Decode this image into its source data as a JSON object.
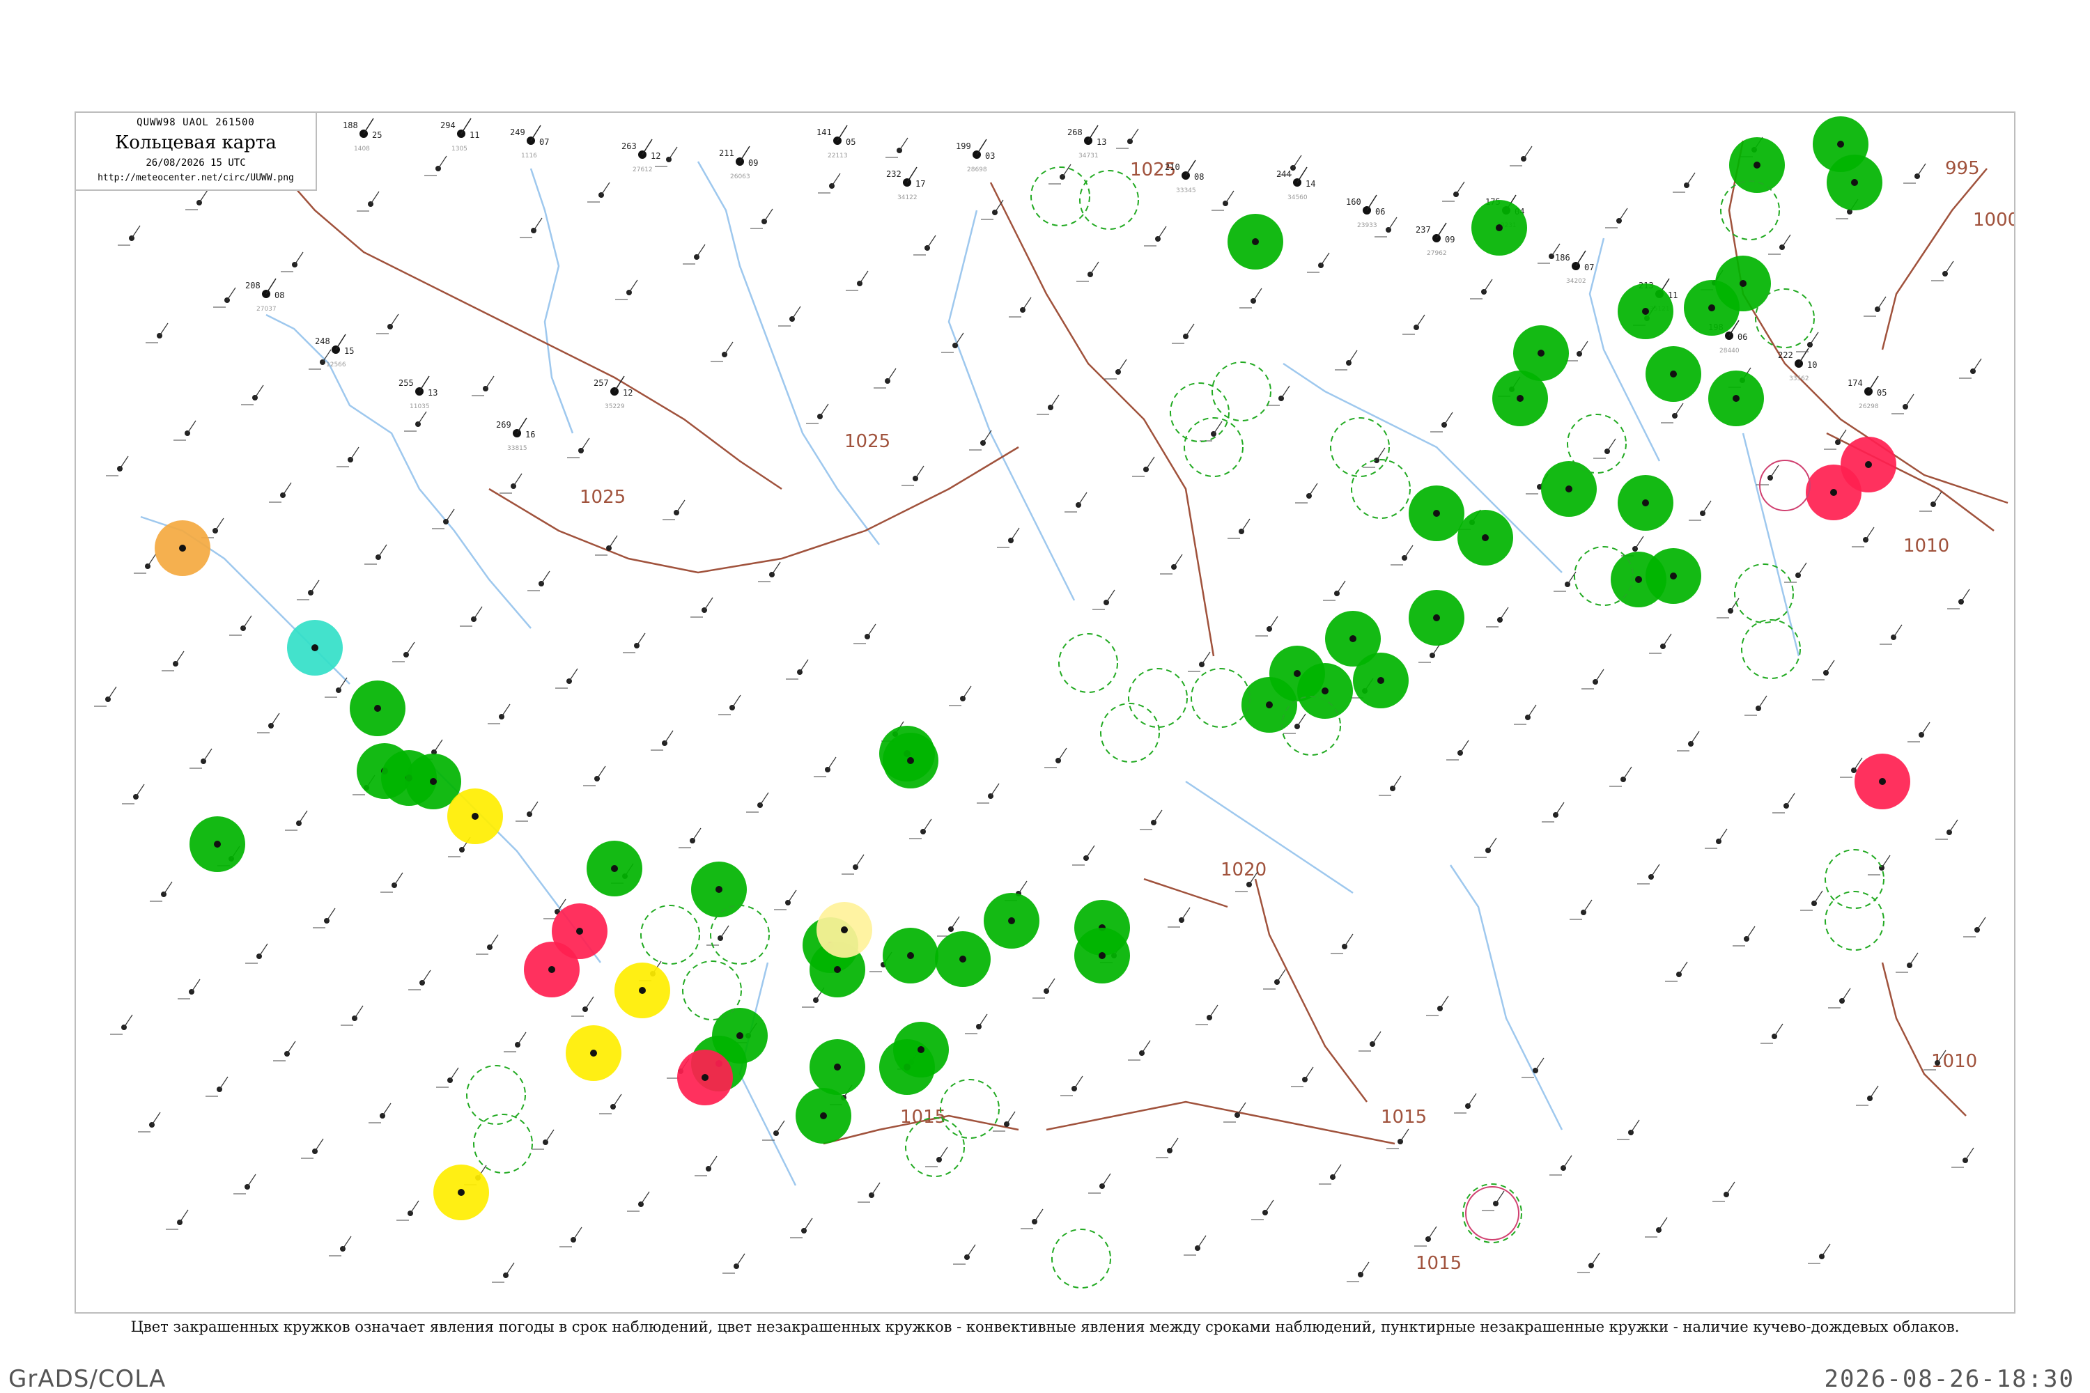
{
  "header": {
    "code": "QUWW98  UAOL  261500",
    "title": "Кольцевая карта",
    "datetime": "26/08/2026 15 UTC",
    "url": "http://meteocenter.net/circ/UUWW.png"
  },
  "caption": "Цвет закрашенных кружков означает явления погоды в срок наблюдений, цвет незакрашенных кружков - конвективные явления между сроками наблюдений, пунктирные незакрашенные кружки - наличие кучево-дождевых облаков.",
  "footer": {
    "left": "GrADS/COLA",
    "right": "2026-08-26-18:30"
  },
  "isobar_labels": [
    "995",
    "1000",
    "1010",
    "1010",
    "1015",
    "1015",
    "1015",
    "1020",
    "1025",
    "1025",
    "1025"
  ],
  "colors": {
    "isobar": "#a0523c",
    "river": "#9ec8ee",
    "border": "#bdbdbd",
    "rain": "#00b400",
    "thunder": "#ff2050",
    "shower": "#ffee00",
    "haze": "#f4a940",
    "fog": "#33e0c8",
    "drizzle": "#fff29a",
    "cb_ring": "#22aa22",
    "conv_ring": "#d04070"
  },
  "phenomena_legend": {
    "rain": "green",
    "thunderstorm": "red",
    "shower": "yellow",
    "haze": "orange",
    "fog": "cyan",
    "cumulonimbus": "dashed ring"
  },
  "stations": [
    {
      "id": "1408",
      "t": "188",
      "p": "25"
    },
    {
      "id": "1305",
      "t": "294",
      "p": "11"
    },
    {
      "id": "1116",
      "t": "249",
      "p": "07"
    },
    {
      "id": "27612",
      "t": "263",
      "p": "12"
    },
    {
      "id": "26063",
      "t": "211",
      "p": "09"
    },
    {
      "id": "22113",
      "t": "141",
      "p": "05"
    },
    {
      "id": "34122",
      "t": "232",
      "p": "17"
    },
    {
      "id": "28698",
      "t": "199",
      "p": "03"
    },
    {
      "id": "34731",
      "t": "268",
      "p": "13"
    },
    {
      "id": "33345",
      "t": "210",
      "p": "08"
    },
    {
      "id": "34560",
      "t": "244",
      "p": "14"
    },
    {
      "id": "23933",
      "t": "160",
      "p": "06"
    },
    {
      "id": "27962",
      "t": "237",
      "p": "09"
    },
    {
      "id": "29231",
      "t": "175",
      "p": "04"
    },
    {
      "id": "34202",
      "t": "186",
      "p": "07"
    },
    {
      "id": "35121",
      "t": "213",
      "p": "11"
    },
    {
      "id": "28440",
      "t": "198",
      "p": "06"
    },
    {
      "id": "33562",
      "t": "222",
      "p": "10"
    },
    {
      "id": "26298",
      "t": "174",
      "p": "05"
    },
    {
      "id": "27037",
      "t": "208",
      "p": "08"
    },
    {
      "id": "12566",
      "t": "248",
      "p": "15"
    },
    {
      "id": "11035",
      "t": "255",
      "p": "13"
    },
    {
      "id": "33815",
      "t": "269",
      "p": "16"
    },
    {
      "id": "35229",
      "t": "257",
      "p": "12"
    }
  ]
}
